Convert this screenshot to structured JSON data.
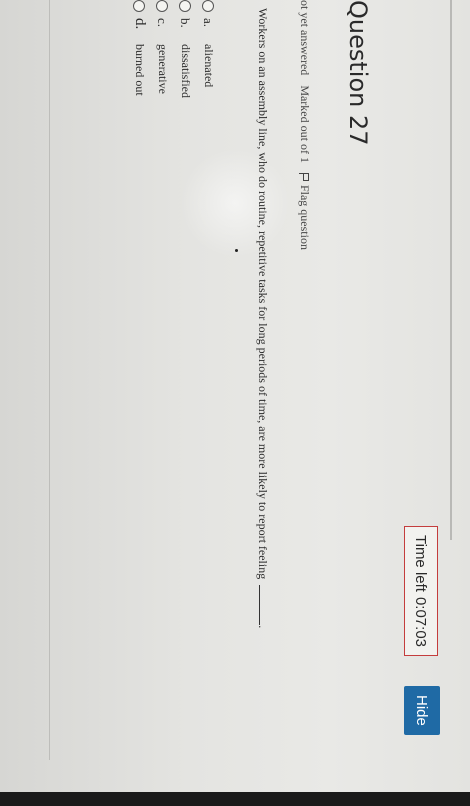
{
  "timer": {
    "label": "Time left",
    "value": "0:07:03"
  },
  "hide_label": "Hide",
  "question": {
    "title": "Question 27",
    "status": "ot yet answered",
    "marks": "Marked out of 1",
    "flag_label": "Flag question",
    "text": "Workers on an assembly line, who do routine, repetitive tasks for long periods of time, are more likely to report feeling",
    "text_end": "."
  },
  "answers": [
    {
      "letter": "a.",
      "text": "alienated"
    },
    {
      "letter": "b.",
      "text": "dissatisfied"
    },
    {
      "letter": "c.",
      "text": "generative"
    },
    {
      "letter": "d.",
      "text": "burned out"
    }
  ],
  "colors": {
    "hide_button": "#1f6aa5",
    "timer_border": "#c43d3d"
  },
  "icons": {
    "flag": "flag-icon",
    "radio": "radio-icon"
  }
}
